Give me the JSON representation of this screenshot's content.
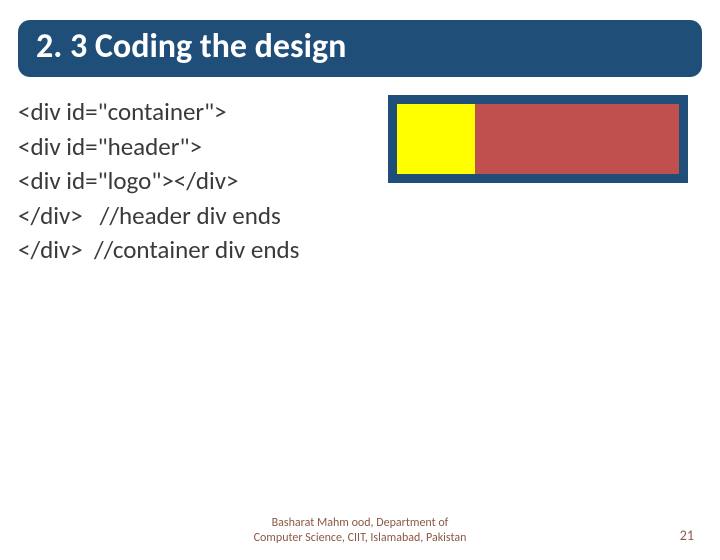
{
  "title": "2. 3 Coding the design",
  "code": {
    "l1": "<div id=\"container\">",
    "l2": "<div id=\"header\">",
    "l3": "<div id=\"logo\"></div>",
    "l4": "</div>   //header div ends",
    "l5": "</div>  //container div ends"
  },
  "diagram": {
    "container_color": "#1f4e79",
    "nav_color": "#385d8a",
    "logo_color": "#ffff00",
    "banner_color": "#c0504d"
  },
  "footer": {
    "line1": "Basharat Mahm ood, Department of",
    "line2": "Computer Science, CIIT, Islamabad, Pakistan"
  },
  "page_number": "21"
}
